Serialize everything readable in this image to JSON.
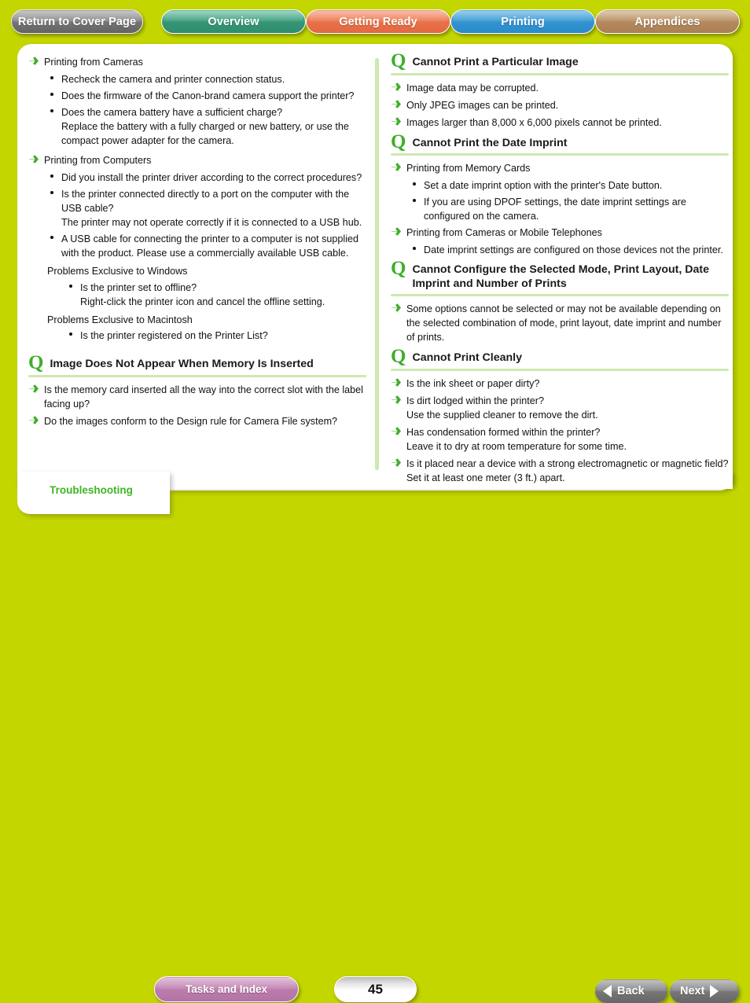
{
  "topnav": {
    "cover": "Return to Cover Page",
    "tabs": [
      {
        "label": "Overview",
        "color": "#3f9f80"
      },
      {
        "label": "Getting Ready",
        "color": "#ec7a52"
      },
      {
        "label": "Printing",
        "color": "#3b9bd6"
      },
      {
        "label": "Appendices",
        "color": "#b99064"
      }
    ]
  },
  "left_column": {
    "continued": {
      "groups": [
        {
          "arrow": "Printing from Cameras",
          "subs": [
            "Recheck the camera and printer connection status.",
            "Does the firmware of the Canon-brand camera support the printer?",
            "Does the camera battery have a sufficient charge?\nReplace the battery with a fully charged or new battery, or use the compact power adapter for the camera."
          ]
        },
        {
          "arrow": "Printing from Computers",
          "subs": [
            "Did you install the printer driver according to the correct procedures?",
            "Is the printer connected directly to a port on the computer with the USB cable?\nThe printer may not operate correctly if it is connected to a USB hub.",
            "A USB cable for connecting the printer to a computer is not supplied with the product. Please use a commercially available USB cable."
          ]
        }
      ],
      "plain_groups": [
        {
          "heading": "Problems Exclusive to Windows",
          "subs": [
            "Is the printer set to offline?\nRight-click the printer icon and cancel the offline setting."
          ]
        },
        {
          "heading": "Problems Exclusive to Macintosh",
          "subs": [
            "Is the printer registered on the Printer List?"
          ]
        }
      ]
    },
    "question": {
      "mark": "Q",
      "title": "Image Does Not Appear When Memory Is Inserted",
      "items": [
        "Is the memory card inserted all the way into the correct slot with the label facing up?",
        "Do the images conform to the Design rule for Camera File system?"
      ]
    }
  },
  "right_column": {
    "q1": {
      "mark": "Q",
      "title": "Cannot Print a Particular Image",
      "items": [
        "Image data may be corrupted.",
        "Only JPEG images can be printed.",
        "Images larger than 8,000 x 6,000 pixels cannot be printed."
      ]
    },
    "q2": {
      "mark": "Q",
      "title": "Cannot Print the Date Imprint",
      "groups": [
        {
          "arrow": "Printing from Memory Cards",
          "subs": [
            "Set a date imprint option with the printer's Date button.",
            "If you are using DPOF settings, the date imprint settings are configured on the camera."
          ]
        },
        {
          "arrow": "Printing from Cameras or Mobile Telephones",
          "subs": [
            "Date imprint settings are configured on those devices not the printer."
          ]
        }
      ]
    },
    "q3": {
      "mark": "Q",
      "title": "Cannot Configure the Selected Mode, Print Layout, Date Imprint and Number of Prints",
      "items": [
        "Some options cannot be selected or may not be available depending on the selected combination of mode, print layout, date imprint and number of prints."
      ]
    },
    "q4": {
      "mark": "Q",
      "title": "Cannot Print Cleanly",
      "items": [
        "Is the ink sheet or paper dirty?",
        "Is dirt lodged within the printer?\nUse the supplied cleaner to remove the dirt.",
        "Has condensation formed within the printer?\nLeave it to dry at room temperature for some time.",
        "Is it placed near a device with a strong electromagnetic or magnetic field?\nSet it at least one meter (3 ft.) apart."
      ]
    }
  },
  "footer": {
    "section_label": "Troubleshooting",
    "tasks_index": "Tasks and Index",
    "page_number": "45",
    "back": "Back",
    "next": "Next"
  },
  "colors": {
    "page_bg": "#c3d600",
    "accent_green": "#3fae29",
    "rule_green": "#cde8b0",
    "section_label_green": "#3cb521"
  }
}
